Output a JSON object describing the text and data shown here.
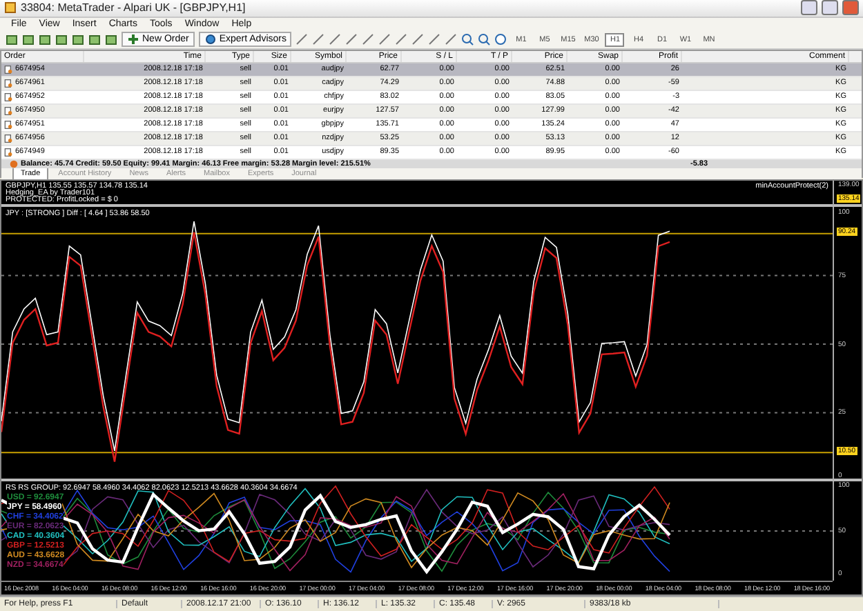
{
  "window": {
    "title": "33804: MetaTrader - Alpari UK - [GBPJPY,H1]"
  },
  "menu": [
    "File",
    "View",
    "Insert",
    "Charts",
    "Tools",
    "Window",
    "Help"
  ],
  "toolbar": {
    "buttons": [
      "New Order",
      "Expert Advisors"
    ],
    "timeframes": [
      {
        "label": "M1",
        "selected": false
      },
      {
        "label": "M5",
        "selected": false
      },
      {
        "label": "M15",
        "selected": false
      },
      {
        "label": "M30",
        "selected": false
      },
      {
        "label": "H1",
        "selected": true
      },
      {
        "label": "H4",
        "selected": false
      },
      {
        "label": "D1",
        "selected": false
      },
      {
        "label": "W1",
        "selected": false
      },
      {
        "label": "MN",
        "selected": false
      }
    ]
  },
  "terminal": {
    "columns": [
      "Order",
      "Time",
      "Type",
      "Size",
      "Symbol",
      "Price",
      "S / L",
      "T / P",
      "Price",
      "Swap",
      "Profit",
      "Comment"
    ],
    "rows": [
      {
        "cells": [
          "6674954",
          "2008.12.18 17:18",
          "sell",
          "0.01",
          "audjpy",
          "62.77",
          "0.00",
          "0.00",
          "62.51",
          "0.00",
          "26",
          "KG"
        ],
        "selected": true
      },
      {
        "cells": [
          "6674961",
          "2008.12.18 17:18",
          "sell",
          "0.01",
          "cadjpy",
          "74.29",
          "0.00",
          "0.00",
          "74.88",
          "0.00",
          "-59",
          "KG"
        ],
        "selected": false
      },
      {
        "cells": [
          "6674952",
          "2008.12.18 17:18",
          "sell",
          "0.01",
          "chfjpy",
          "83.02",
          "0.00",
          "0.00",
          "83.05",
          "0.00",
          "-3",
          "KG"
        ],
        "selected": false
      },
      {
        "cells": [
          "6674950",
          "2008.12.18 17:18",
          "sell",
          "0.01",
          "eurjpy",
          "127.57",
          "0.00",
          "0.00",
          "127.99",
          "0.00",
          "-42",
          "KG"
        ],
        "selected": false
      },
      {
        "cells": [
          "6674951",
          "2008.12.18 17:18",
          "sell",
          "0.01",
          "gbpjpy",
          "135.71",
          "0.00",
          "0.00",
          "135.24",
          "0.00",
          "47",
          "KG"
        ],
        "selected": false
      },
      {
        "cells": [
          "6674956",
          "2008.12.18 17:18",
          "sell",
          "0.01",
          "nzdjpy",
          "53.25",
          "0.00",
          "0.00",
          "53.13",
          "0.00",
          "12",
          "KG"
        ],
        "selected": false
      },
      {
        "cells": [
          "6674949",
          "2008.12.18 17:18",
          "sell",
          "0.01",
          "usdjpy",
          "89.35",
          "0.00",
          "0.00",
          "89.95",
          "0.00",
          "-60",
          "KG"
        ],
        "selected": false
      }
    ],
    "summary": "Balance: 45.74  Credit: 59.50  Equity: 99.41  Margin: 46.13  Free margin: 53.28  Margin level: 215.51%",
    "summary_profit": "-5.83",
    "tabs": [
      {
        "label": "Trade",
        "selected": true
      },
      {
        "label": "Account History",
        "selected": false
      },
      {
        "label": "News",
        "selected": false
      },
      {
        "label": "Alerts",
        "selected": false
      },
      {
        "label": "Mailbox",
        "selected": false
      },
      {
        "label": "Experts",
        "selected": false
      },
      {
        "label": "Journal",
        "selected": false
      }
    ]
  },
  "chart": {
    "price_panel": {
      "lines": [
        "GBPJPY,H1  135.55 135.57 134.78 135.14",
        "Hedging_EA by Trader101",
        "PROTECTED: ProfitLocked = $ 0"
      ],
      "expert": "minAccountProtect(2)",
      "axis": [
        "139.00",
        "135.14"
      ]
    },
    "strength_panel": {
      "caption": "JPY : [STRONG ]   Diff : [ 4.64 ]     53.86 58.50",
      "upper_level": "90.24",
      "lower_level": "10.50",
      "axis": [
        "100",
        "75",
        "50",
        "25",
        "0"
      ]
    },
    "group_panel": {
      "caption": "RS RS GROUP:  92.6947 58.4960 34.4062 82.0623 12.5213 43.6628 40.3604 34.6674",
      "axis": [
        "100",
        "50",
        "0"
      ],
      "legend": [
        {
          "label": "USD = 92.6947",
          "color": "#1e8c3c"
        },
        {
          "label": "JPY = 58.4960",
          "color": "#ffffff"
        },
        {
          "label": "CHF = 34.4062",
          "color": "#2040e0"
        },
        {
          "label": "EUR = 82.0623",
          "color": "#6a2a7a"
        },
        {
          "label": "CAD = 40.3604",
          "color": "#20c0c0"
        },
        {
          "label": "GBP = 12.5213",
          "color": "#d02020"
        },
        {
          "label": "AUD = 43.6628",
          "color": "#d08a20"
        },
        {
          "label": "NZD = 34.6674",
          "color": "#a02060"
        }
      ]
    },
    "time_axis": [
      "16 Dec 2008",
      "16 Dec 04:00",
      "16 Dec 08:00",
      "16 Dec 12:00",
      "16 Dec 16:00",
      "16 Dec 20:00",
      "17 Dec 00:00",
      "17 Dec 04:00",
      "17 Dec 08:00",
      "17 Dec 12:00",
      "17 Dec 16:00",
      "17 Dec 20:00",
      "18 Dec 00:00",
      "18 Dec 04:00",
      "18 Dec 08:00",
      "18 Dec 12:00",
      "18 Dec 16:00"
    ]
  },
  "status_bar": [
    "For Help, press F1",
    "Default",
    "2008.12.17 21:00",
    "O: 136.10",
    "H: 136.12",
    "L: 135.32",
    "C: 135.48",
    "V: 2965",
    "9383/18 kb"
  ]
}
